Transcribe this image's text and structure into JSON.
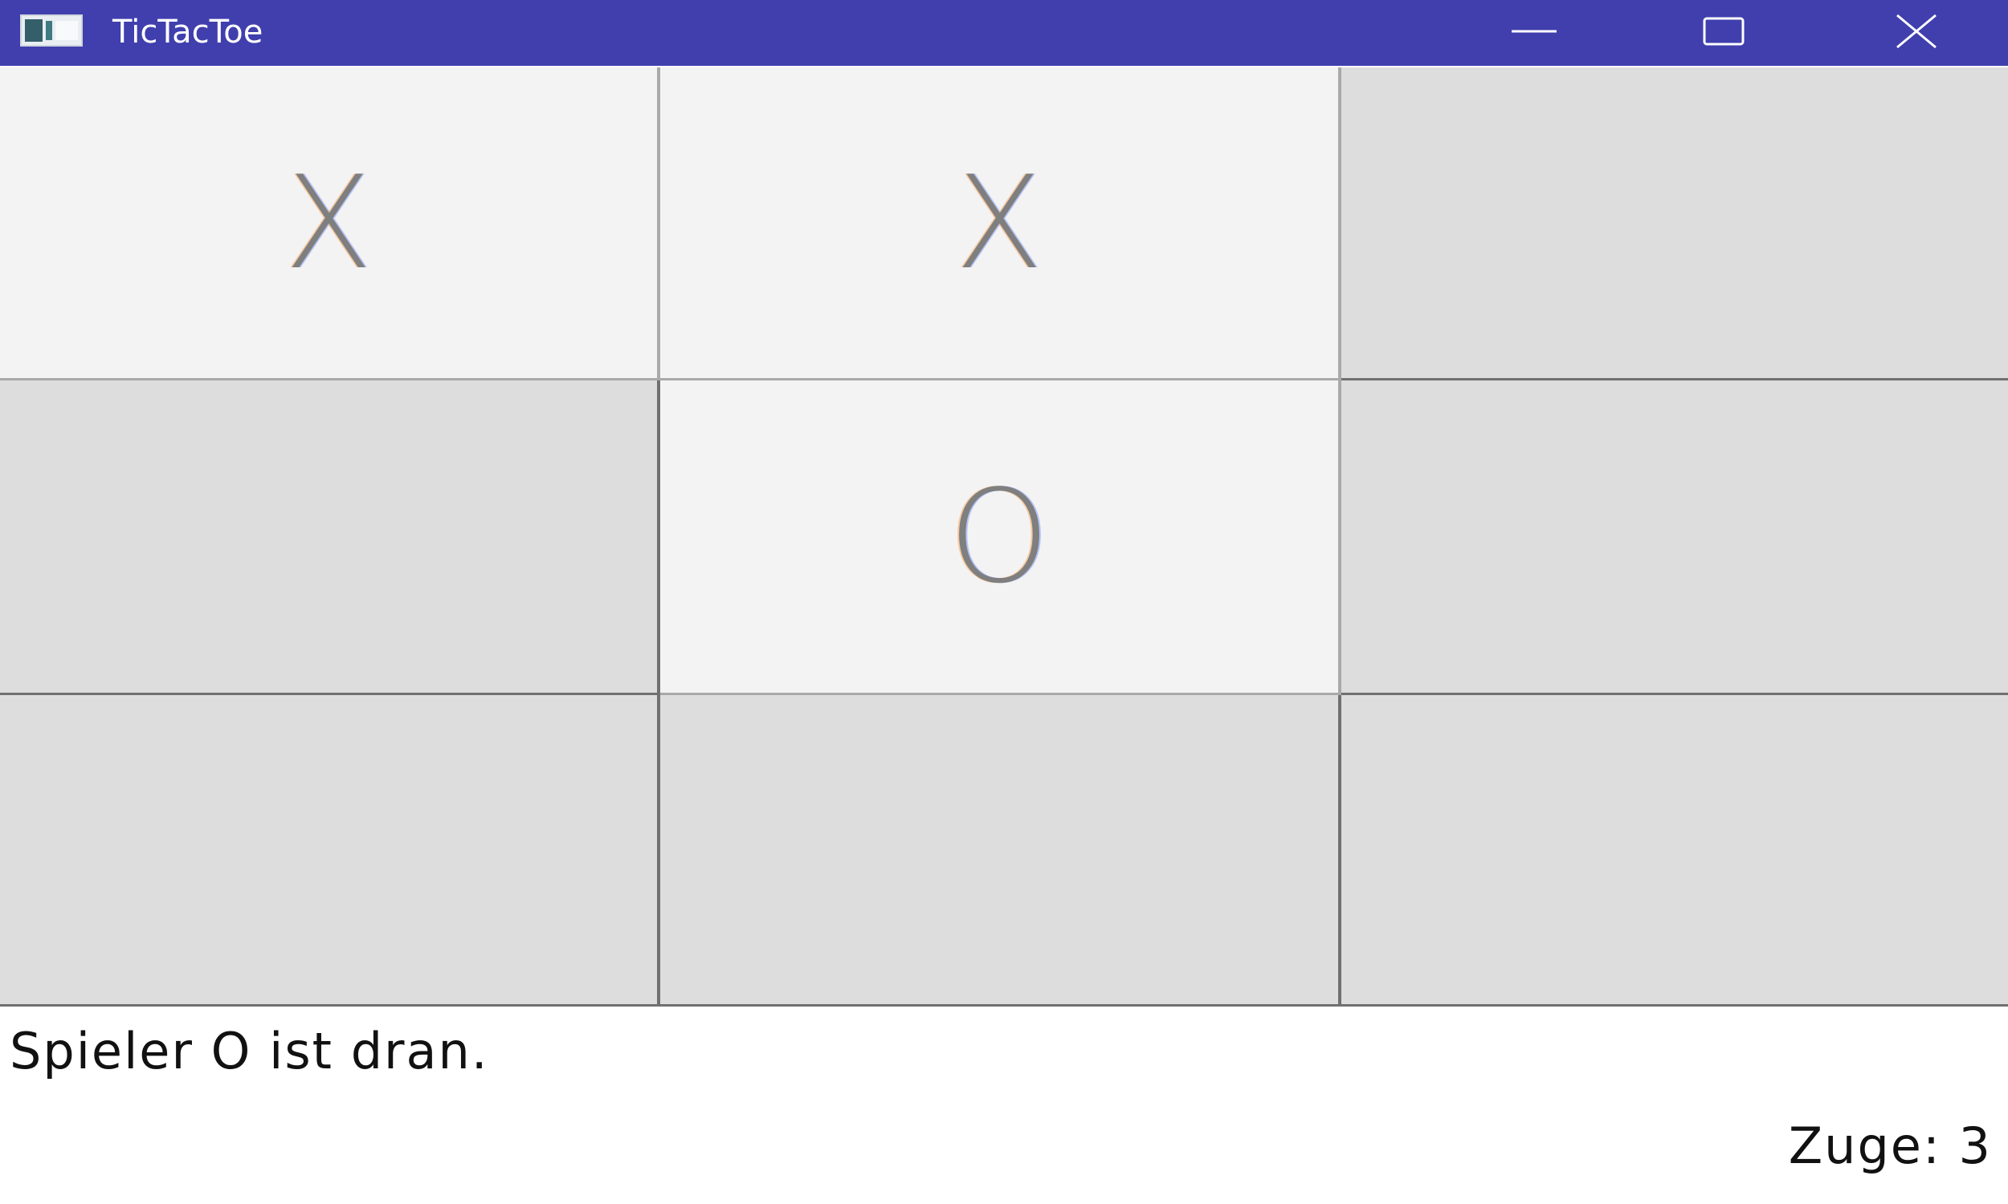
{
  "window": {
    "title": "TicTacToe",
    "app_icon": "app-window-icon",
    "controls": {
      "minimize_icon": "minimize-icon",
      "maximize_icon": "maximize-icon",
      "close_icon": "close-icon"
    }
  },
  "colors": {
    "titlebar": "#403fad",
    "cell_active": "#f3f3f3",
    "cell_empty": "#dddddd",
    "mark": "#7f7f7f",
    "grid_line": "#707070"
  },
  "board": {
    "rows": [
      [
        "X",
        "X",
        ""
      ],
      [
        "",
        "O",
        ""
      ],
      [
        "",
        "",
        ""
      ]
    ]
  },
  "status": {
    "message": "Spieler O ist dran.",
    "moves_label": "Zuge: 3"
  }
}
